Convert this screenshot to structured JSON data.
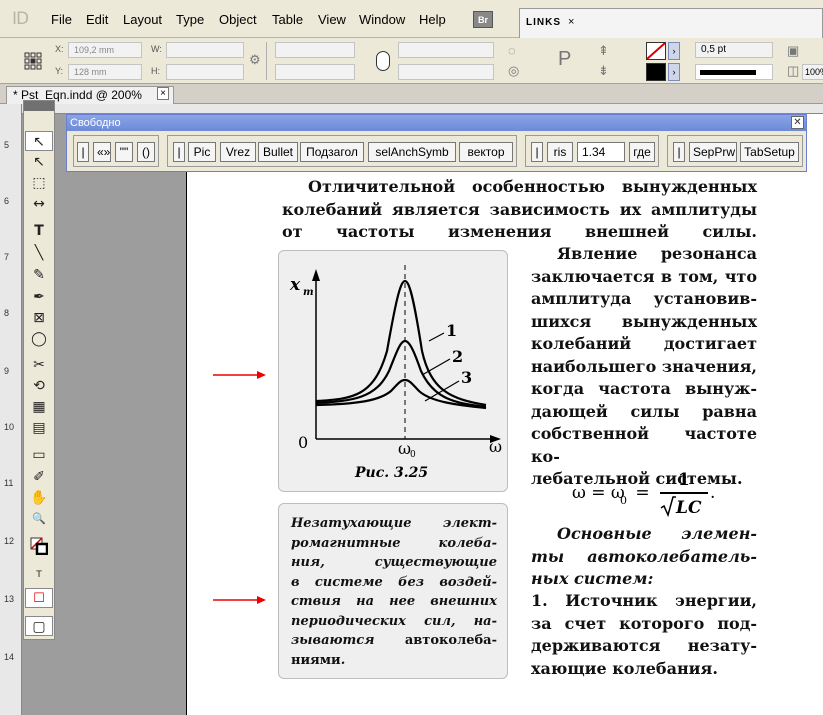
{
  "app": {
    "logo": "ID",
    "menu": [
      "File",
      "Edit",
      "Layout",
      "Type",
      "Object",
      "Table",
      "View",
      "Window",
      "Help"
    ],
    "bridge_button": "Br",
    "links_panel_tab": "LINKS",
    "links_panel_close": "×"
  },
  "control_bar": {
    "x_label": "X:",
    "x_value": "109,2 mm",
    "y_label": "Y:",
    "y_value": "128 mm",
    "w_label": "W:",
    "h_label": "H:",
    "stroke_weight": "0,5 pt",
    "zoom_value": "100%"
  },
  "document": {
    "tab_title": "*  Pst_Eqn.indd @ 200%",
    "tab_close": "×"
  },
  "vruler": [
    "5",
    "6",
    "7",
    "8",
    "9",
    "10",
    "11",
    "12",
    "13",
    "14"
  ],
  "tools": {
    "labels": [
      "↖",
      "↖",
      "⬚",
      "↔",
      "T",
      "╲",
      "✎",
      "✒",
      "⊠",
      "◯",
      "✂",
      "⟲",
      "▦",
      "▤",
      "▭",
      "✐",
      "✋",
      "🔍",
      "■",
      "T",
      "☐",
      "▢"
    ]
  },
  "script_panel": {
    "title": "Свободно",
    "close": "✕",
    "group1": [
      "|",
      "«»",
      "\"\"",
      "()"
    ],
    "group2": [
      "|",
      "Pic",
      "Vrez",
      "Bullet",
      "Подзагол",
      "selAnchSymb",
      "вектор"
    ],
    "group3": [
      "|",
      "ris",
      "1.34",
      "где"
    ],
    "group4": [
      "|",
      "SepPrw",
      "TabSetup"
    ]
  },
  "page": {
    "intro_lines": [
      "Отличительной особенностью вынужденных",
      "колебаний является зависимость их амплитуды",
      "от частоты изменения внешней силы."
    ],
    "resonance_lines": [
      "Явление резонанса",
      "заключается в том, что",
      "амплитуда установив-",
      "шихся вынужденных",
      "колебаний достигает",
      "наибольшего значения,",
      "когда частота вынуж-",
      "дающей силы равна",
      "собственной частоте ко-",
      "лебательной системы."
    ],
    "formula": {
      "left": "ω = ω",
      "sub": "0",
      "eq": " = ",
      "num": "1",
      "den": "LC",
      "end": "."
    },
    "elements_lines": [
      "Основные элемен-",
      "ты автоколебатель-",
      "ных систем:"
    ],
    "item1_lines": [
      "1. Источник энергии,",
      "за счет которого под-",
      "держиваются незату-",
      "хающие колебания."
    ],
    "note_lines": [
      "Незатухающие элект-",
      "ромагнитные колеба-",
      "ния, существующие",
      "в системе без воздей-",
      "ствия на нее внешних",
      "периодических сил, на-"
    ],
    "note_last_prefix": "зываются ",
    "note_last_bold": "автоколеба-",
    "note_final_bold": "ниями",
    "note_final_end": ".",
    "figure": {
      "caption": "Рис. 3.25",
      "y_axis": "x",
      "y_axis_sub": "m",
      "origin": "0",
      "x_axis": "ω",
      "peak_label": "ω",
      "peak_sub": "0",
      "curve_labels": [
        "1",
        "2",
        "3"
      ]
    }
  }
}
